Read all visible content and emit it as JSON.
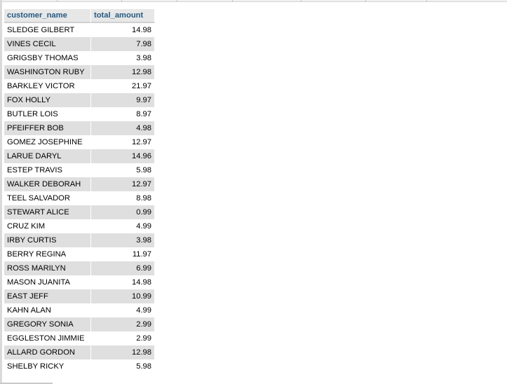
{
  "table": {
    "columns": [
      "customer_name",
      "total_amount"
    ],
    "rows": [
      [
        "SLEDGE GILBERT",
        "14.98"
      ],
      [
        "VINES CECIL",
        "7.98"
      ],
      [
        "GRIGSBY THOMAS",
        "3.98"
      ],
      [
        "WASHINGTON RUBY",
        "12.98"
      ],
      [
        "BARKLEY VICTOR",
        "21.97"
      ],
      [
        "FOX HOLLY",
        "9.97"
      ],
      [
        "BUTLER LOIS",
        "8.97"
      ],
      [
        "PFEIFFER BOB",
        "4.98"
      ],
      [
        "GOMEZ JOSEPHINE",
        "12.97"
      ],
      [
        "LARUE DARYL",
        "14.96"
      ],
      [
        "ESTEP TRAVIS",
        "5.98"
      ],
      [
        "WALKER DEBORAH",
        "12.97"
      ],
      [
        "TEEL SALVADOR",
        "8.98"
      ],
      [
        "STEWART ALICE",
        "0.99"
      ],
      [
        "CRUZ KIM",
        "4.99"
      ],
      [
        "IRBY CURTIS",
        "3.98"
      ],
      [
        "BERRY REGINA",
        "11.97"
      ],
      [
        "ROSS MARILYN",
        "6.99"
      ],
      [
        "MASON JUANITA",
        "14.98"
      ],
      [
        "EAST JEFF",
        "10.99"
      ],
      [
        "KAHN ALAN",
        "4.99"
      ],
      [
        "GREGORY SONIA",
        "2.99"
      ],
      [
        "EGGLESTON JIMMIE",
        "2.99"
      ],
      [
        "ALLARD GORDON",
        "12.98"
      ],
      [
        "SHELBY RICKY",
        "5.98"
      ]
    ]
  },
  "colors": {
    "header_text": "#235a81",
    "header_bg": "#e7e7e7",
    "row_even_bg": "#dfdfdf",
    "row_odd_bg": "#ffffff"
  }
}
